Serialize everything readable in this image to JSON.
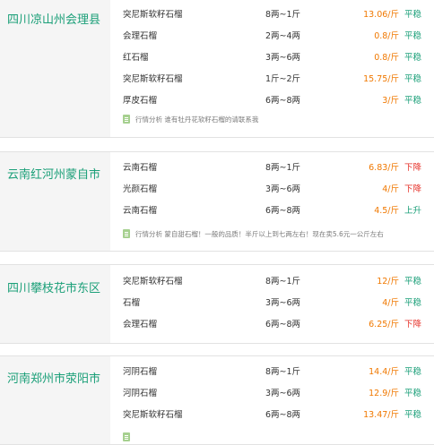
{
  "groups": [
    {
      "region": "四川凉山州会理县",
      "rows": [
        {
          "name": "突尼斯软籽石榴",
          "spec": "8两~1斤",
          "price": "13.06/斤",
          "trend": "平稳"
        },
        {
          "name": "会理石榴",
          "spec": "2两~4两",
          "price": "0.8/斤",
          "trend": "平稳"
        },
        {
          "name": "红石榴",
          "spec": "3两~6两",
          "price": "0.8/斤",
          "trend": "平稳"
        },
        {
          "name": "突尼斯软籽石榴",
          "spec": "1斤~2斤",
          "price": "15.75/斤",
          "trend": "平稳"
        },
        {
          "name": "厚皮石榴",
          "spec": "6两~8两",
          "price": "3/斤",
          "trend": "平稳"
        }
      ],
      "analysis": "行情分析 谁有牡丹花软籽石榴的请联系我"
    },
    {
      "region": "云南红河州蒙自市",
      "rows": [
        {
          "name": "云南石榴",
          "spec": "8两~1斤",
          "price": "6.83/斤",
          "trend": "下降"
        },
        {
          "name": "光颜石榴",
          "spec": "3两~6两",
          "price": "4/斤",
          "trend": "下降"
        },
        {
          "name": "云南石榴",
          "spec": "6两~8两",
          "price": "4.5/斤",
          "trend": "上升"
        }
      ],
      "analysis": "行情分析 蒙自甜石榴！一般的品质！半斤以上到七两左右！现在卖5.6元一公斤左右"
    },
    {
      "region": "四川攀枝花市东区",
      "rows": [
        {
          "name": "突尼斯软籽石榴",
          "spec": "8两~1斤",
          "price": "12/斤",
          "trend": "平稳"
        },
        {
          "name": "石榴",
          "spec": "3两~6两",
          "price": "4/斤",
          "trend": "平稳"
        },
        {
          "name": "会理石榴",
          "spec": "6两~8两",
          "price": "6.25/斤",
          "trend": "下降"
        }
      ]
    },
    {
      "region": "河南郑州市荥阳市",
      "rows": [
        {
          "name": "河阴石榴",
          "spec": "8两~1斤",
          "price": "14.4/斤",
          "trend": "平稳"
        },
        {
          "name": "河阴石榴",
          "spec": "3两~6两",
          "price": "12.9/斤",
          "trend": "平稳"
        },
        {
          "name": "突尼斯软籽石榴",
          "spec": "6两~8两",
          "price": "13.47/斤",
          "trend": "平稳"
        }
      ]
    }
  ],
  "colors": {
    "region": "#1a9f78",
    "price": "#f07800",
    "trend_flat": "#1a9f78",
    "trend_down": "#e6322a"
  }
}
